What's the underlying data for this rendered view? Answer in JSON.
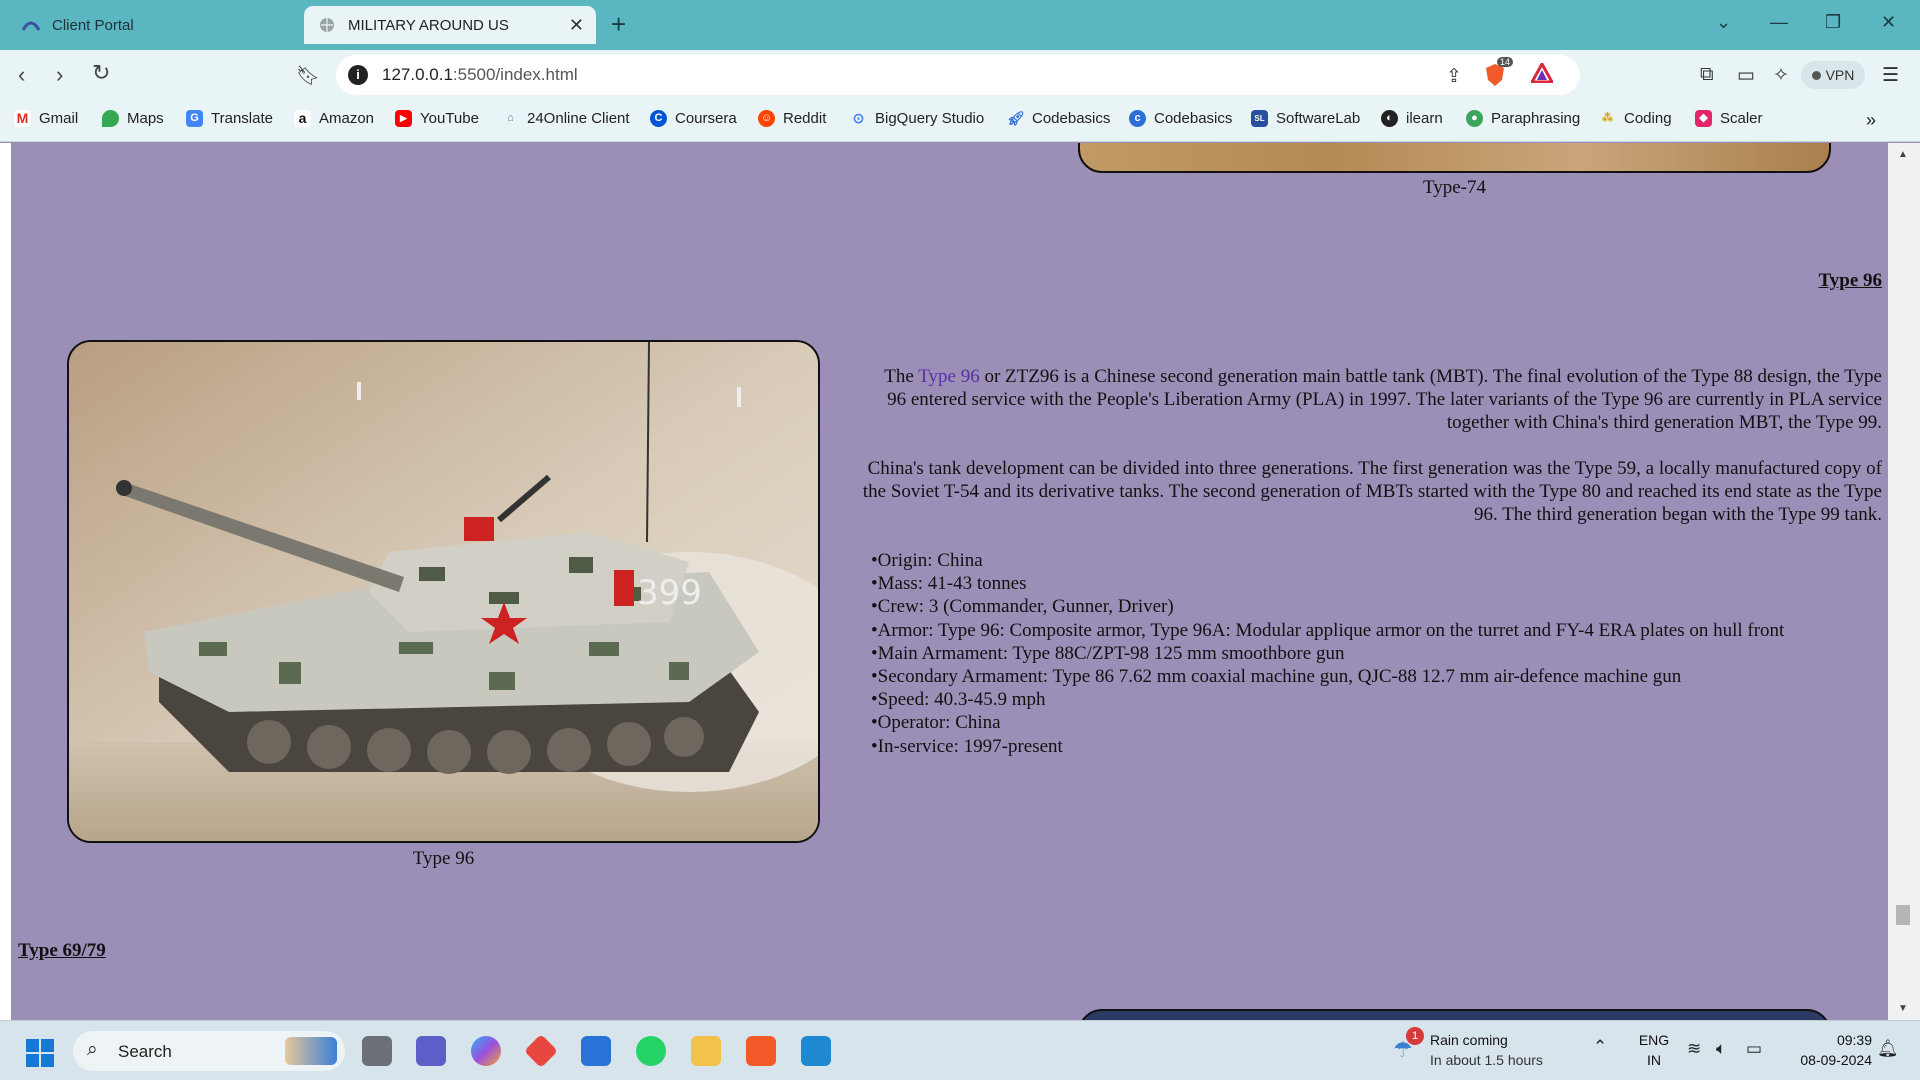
{
  "browser": {
    "tabs": [
      {
        "label": "Client Portal",
        "active": false
      },
      {
        "label": "MILITARY AROUND US",
        "active": true
      }
    ],
    "address": {
      "host": "127.0.0.1",
      "rest": ":5500/index.html"
    },
    "shield_count": "14",
    "vpn_label": "VPN",
    "bookmarks": [
      "Gmail",
      "Maps",
      "Translate",
      "Amazon",
      "YouTube",
      "24Online Client",
      "Coursera",
      "Reddit",
      "BigQuery Studio",
      "Codebasics",
      "Codebasics",
      "SoftwareLab",
      "ilearn",
      "Paraphrasing",
      "Coding",
      "Scaler"
    ]
  },
  "page": {
    "type74_caption": "Type-74",
    "type96_heading": "Type 96",
    "type96_caption": "Type 96",
    "para1": {
      "before": "The ",
      "link": "Type 96",
      "after": " or ZTZ96 is a Chinese second generation main battle tank (MBT). The final evolution of the Type 88 design, the Type 96 entered service with the People's Liberation Army (PLA) in 1997. The later variants of the Type 96 are currently in PLA service together with China's third generation MBT, the Type 99."
    },
    "para2": "China's tank development can be divided into three generations. The first generation was the Type 59, a locally manufactured copy of the Soviet T-54 and its derivative tanks. The second generation of MBTs started with the Type 80 and reached its end state as the Type 96. The third generation began with the Type 99 tank.",
    "specs": [
      "Origin: China",
      "Mass: 41-43 tonnes",
      "Crew: 3 (Commander, Gunner, Driver)",
      "Armor: Type 96: Composite armor, Type 96A: Modular applique armor on the turret and FY-4 ERA plates on hull front",
      "Main Armament: Type 88C/ZPT-98 125 mm smoothbore gun",
      "Secondary Armament: Type 86 7.62 mm coaxial machine gun, QJC-88 12.7 mm air-defence machine gun",
      "Speed: 40.3-45.9 mph",
      "Operator: China",
      "In-service: 1997-present"
    ],
    "turret_number": "399",
    "type6979_heading": "Type 69/79"
  },
  "taskbar": {
    "search_label": "Search",
    "weather_line1": "Rain coming",
    "weather_line2": "In about 1.5 hours",
    "weather_badge": "1",
    "lang_line1": "ENG",
    "lang_line2": "IN",
    "time": "09:39",
    "date": "08-09-2024"
  },
  "colors": {
    "page_bg": "#9b8fb8",
    "tabbar_bg": "#5ab6c1",
    "link": "#5a2ea6"
  }
}
